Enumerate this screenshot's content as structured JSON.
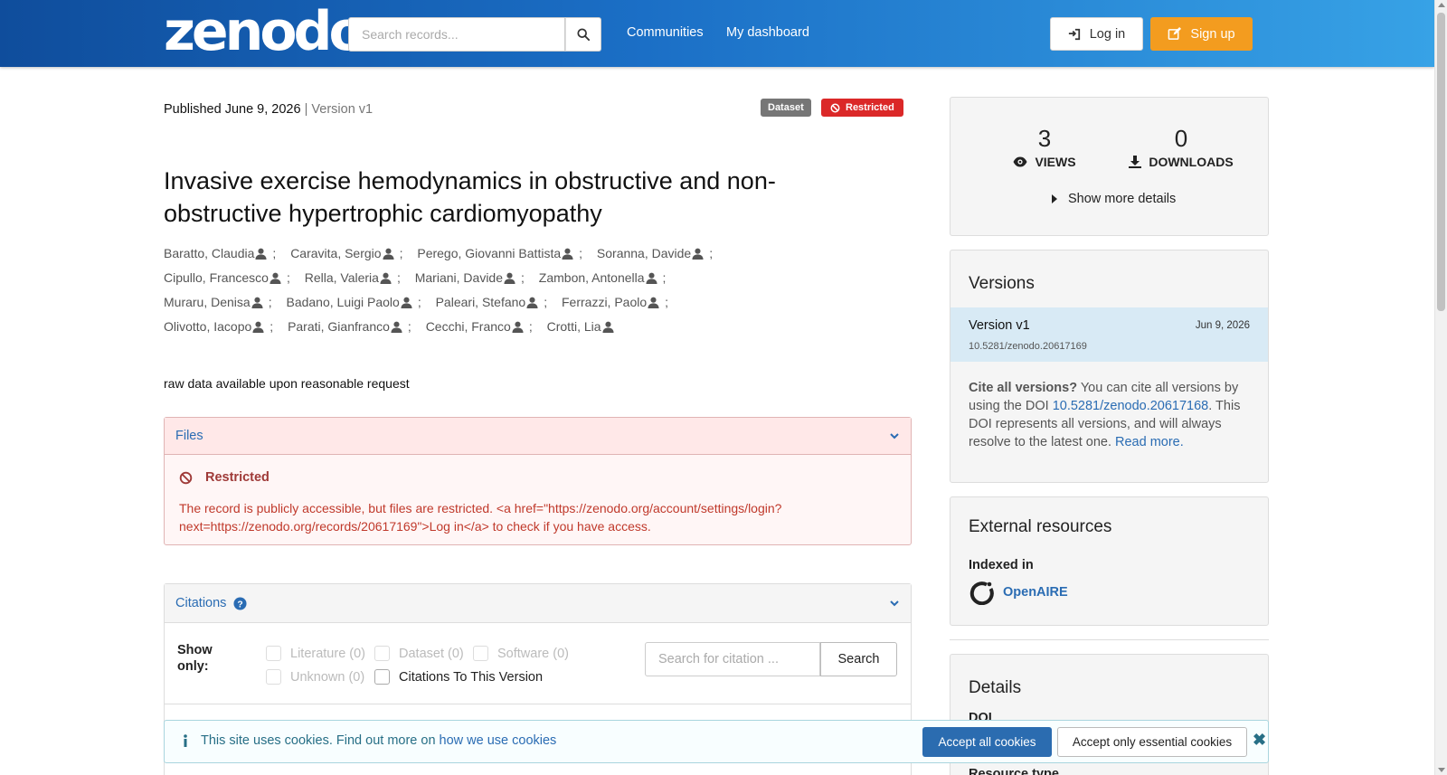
{
  "header": {
    "logo": "zenodo",
    "search_placeholder": "Search records...",
    "nav": [
      "Communities",
      "My dashboard"
    ],
    "login_label": "Log in",
    "signup_label": "Sign up"
  },
  "record": {
    "published_label": "Published June 9, 2026",
    "version_label": "| Version v1",
    "badges": {
      "type": "Dataset",
      "access": "Restricted"
    },
    "title": "Invasive exercise hemodynamics in obstructive and non-obstructive hypertrophic cardiomyopathy",
    "authors": [
      [
        "Baratto, Claudia",
        "Caravita, Sergio",
        "Perego, Giovanni Battista",
        "Soranna, Davide"
      ],
      [
        "Cipullo, Francesco",
        "Rella, Valeria",
        "Mariani, Davide",
        "Zambon, Antonella"
      ],
      [
        "Muraru, Denisa",
        "Badano, Luigi Paolo",
        "Paleari, Stefano",
        "Ferrazzi, Paolo"
      ],
      [
        "Olivotto, Iacopo",
        "Parati, Gianfranco",
        "Cecchi, Franco",
        "Crotti, Lia"
      ]
    ],
    "description": "raw data available upon reasonable request"
  },
  "files": {
    "header": "Files",
    "restricted_title": "Restricted",
    "restricted_message": "The record is publicly accessible, but files are restricted. <a href=\"https://zenodo.org/account/settings/login?next=https://zenodo.org/records/20617169\">Log in</a> to check if you have access."
  },
  "citations": {
    "header": "Citations",
    "show_only_label": "Show only:",
    "filters": [
      {
        "label": "Literature (0)",
        "enabled": false
      },
      {
        "label": "Dataset (0)",
        "enabled": false
      },
      {
        "label": "Software (0)",
        "enabled": false
      },
      {
        "label": "Unknown (0)",
        "enabled": false
      },
      {
        "label": "Citations To This Version",
        "enabled": true
      }
    ],
    "search_placeholder": "Search for citation ...",
    "search_button": "Search"
  },
  "stats": {
    "views": "3",
    "views_label": "VIEWS",
    "downloads": "0",
    "downloads_label": "DOWNLOADS",
    "more_details": "Show more details"
  },
  "versions": {
    "title": "Versions",
    "items": [
      {
        "name": "Version v1",
        "doi": "10.5281/zenodo.20617169",
        "date": "Jun 9, 2026"
      }
    ],
    "cite_all_bold": "Cite all versions?",
    "cite_all_text1": " You can cite all versions by using the DOI ",
    "cite_all_doi": "10.5281/zenodo.20617168",
    "cite_all_text2": ". This DOI represents all versions, and will always resolve to the latest one. ",
    "read_more": "Read more."
  },
  "external": {
    "title": "External resources",
    "indexed_label": "Indexed in",
    "resource": "OpenAIRE"
  },
  "details": {
    "title": "Details",
    "doi_label": "DOI",
    "resource_type_label": "Resource type"
  },
  "cookie": {
    "message": "This site uses cookies. Find out more on ",
    "link": "how we use cookies",
    "accept_all": "Accept all cookies",
    "accept_essential": "Accept only essential cookies"
  },
  "colors": {
    "header_gradient_start": "#0f4d9c",
    "header_gradient_end": "#37a2e6",
    "signup": "#f39c1f",
    "restricted": "#db2828",
    "link": "#2a6cb3"
  }
}
